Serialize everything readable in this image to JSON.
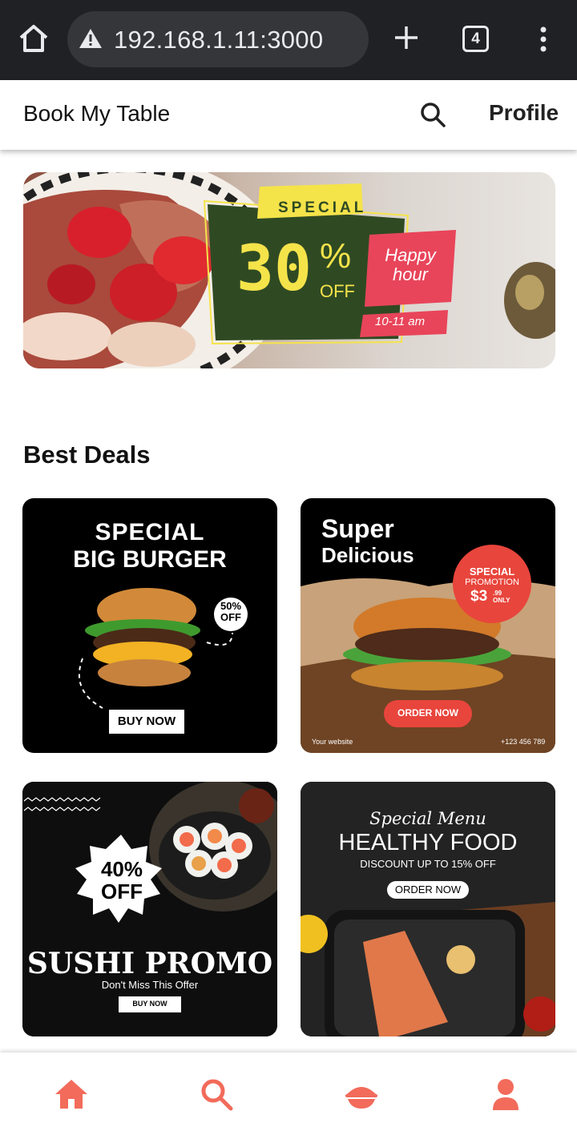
{
  "browser": {
    "url": "192.168.1.11:3000",
    "tab_count": "4"
  },
  "header": {
    "title": "Book My Table",
    "profile_label": "Profile"
  },
  "hero": {
    "badge": "SPECIAL",
    "discount": "30",
    "percent": "%",
    "off": "OFF",
    "happy_hour": "Happy hour",
    "time": "10-11 am"
  },
  "best_deals": {
    "title": "Best Deals",
    "cards": [
      {
        "line1": "SPECIAL",
        "line2": "BIG BURGER",
        "badge": "50% OFF",
        "cta": "BUY NOW"
      },
      {
        "line1": "Super",
        "line2": "Delicious",
        "promo_1": "SPECIAL",
        "promo_2": "PROMOTION",
        "price": "$3",
        "cents": ".99",
        "only": "ONLY",
        "cta": "ORDER NOW",
        "footer_left": "Your website",
        "footer_right": "+123 456 789"
      },
      {
        "badge_1": "40%",
        "badge_2": "OFF",
        "title": "SUSHI PROMO",
        "subtitle": "Don't Miss This Offer",
        "cta": "BUY NOW"
      },
      {
        "script": "Special Menu",
        "title": "HEALTHY FOOD",
        "subtitle": "DISCOUNT UP TO 15% OFF",
        "cta": "ORDER NOW"
      }
    ]
  },
  "colors": {
    "accent": "#f26b5b",
    "browser_bg": "#202124",
    "promo_red": "#e8453c"
  },
  "icons": {
    "nav_home": "home-icon",
    "nav_search": "search-icon",
    "nav_bookings": "food-bowl-icon",
    "nav_profile": "user-icon"
  }
}
